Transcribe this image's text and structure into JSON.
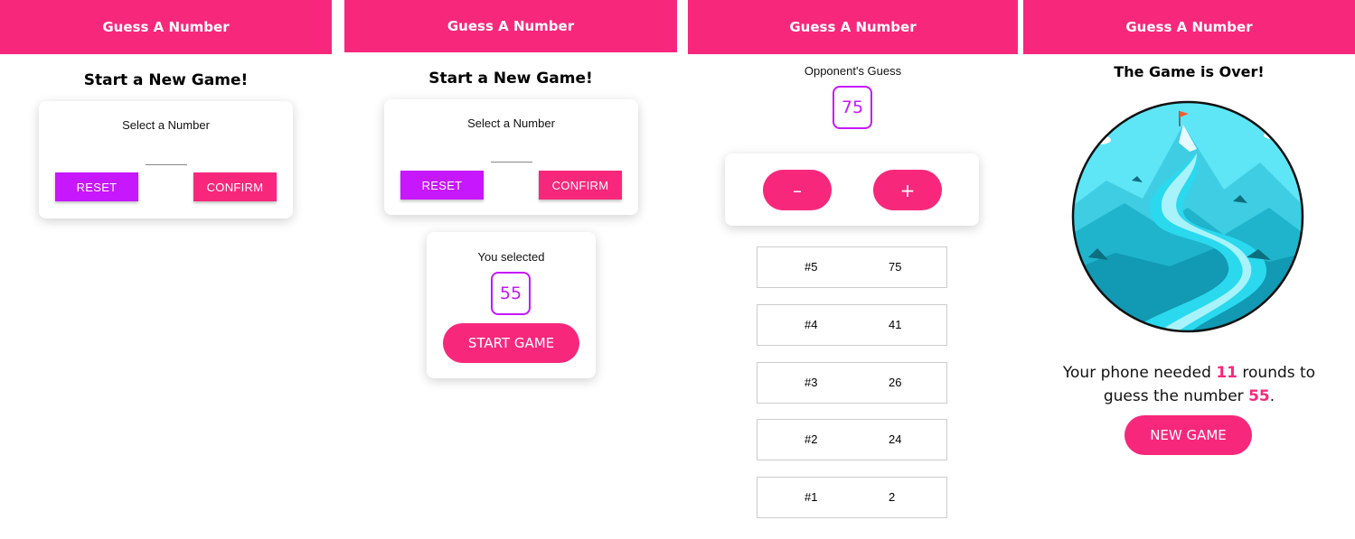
{
  "app": {
    "title": "Guess A Number"
  },
  "colors": {
    "primary": "#f7287b",
    "accent": "#c717fc"
  },
  "screen1": {
    "title": "Start a New Game!",
    "card_label": "Select a Number",
    "input_value": "",
    "reset_label": "RESET",
    "confirm_label": "CONFIRM"
  },
  "screen2": {
    "title": "Start a New Game!",
    "card_label": "Select a Number",
    "input_value": "",
    "reset_label": "RESET",
    "confirm_label": "CONFIRM",
    "selected_label": "You selected",
    "selected_number": "55",
    "start_label": "START GAME"
  },
  "screen3": {
    "opponent_label": "Opponent's Guess",
    "guess": "75",
    "lower_label": "–",
    "higher_label": "+",
    "rounds": [
      {
        "round": "#5",
        "value": "75"
      },
      {
        "round": "#4",
        "value": "41"
      },
      {
        "round": "#3",
        "value": "26"
      },
      {
        "round": "#2",
        "value": "24"
      },
      {
        "round": "#1",
        "value": "2"
      }
    ]
  },
  "screen4": {
    "title": "The Game is Over!",
    "image_icon": "mountain-river-illustration",
    "result_part1": "Your phone needed ",
    "rounds_count": "11",
    "result_part2": " rounds to",
    "result_part3": "guess the number ",
    "number": "55",
    "result_part4": ".",
    "new_game_label": "NEW GAME"
  }
}
